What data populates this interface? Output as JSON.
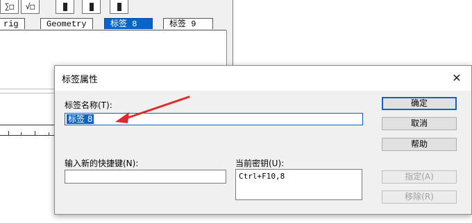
{
  "background": {
    "toolbar": {
      "buttons": [
        {
          "glyph": "∑□"
        },
        {
          "glyph": "√□"
        },
        {
          "glyph": ""
        },
        {
          "glyph": ""
        },
        {
          "glyph": ""
        }
      ]
    },
    "tabs": [
      {
        "label": "rig"
      },
      {
        "label": "Geometry"
      },
      {
        "label": "标签 8"
      },
      {
        "label": "标签 9"
      }
    ]
  },
  "dialog": {
    "title": "标签属性",
    "name_label": "标签名称(T):",
    "name_value": "标签 8",
    "hotkey_label": "输入新的快捷键(N):",
    "hotkey_value": "",
    "current_label": "当前密钥(U):",
    "current_value": "Ctrl+F10,8",
    "buttons": {
      "ok": "确定",
      "cancel": "取消",
      "help": "帮助",
      "assign": "指定(A)",
      "remove": "移除(R)"
    },
    "accent": "#0a64c8",
    "annotation_color": "#e0282d"
  }
}
